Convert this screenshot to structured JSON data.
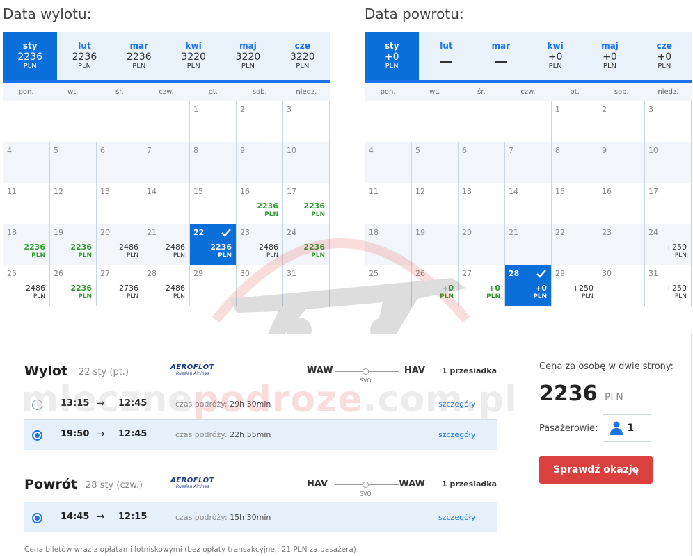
{
  "outbound": {
    "title": "Data wylotu:",
    "months": [
      {
        "name": "sty",
        "price": "2236",
        "currency": "PLN",
        "active": true
      },
      {
        "name": "lut",
        "price": "2236",
        "currency": "PLN"
      },
      {
        "name": "mar",
        "price": "2236",
        "currency": "PLN"
      },
      {
        "name": "kwi",
        "price": "3220",
        "currency": "PLN"
      },
      {
        "name": "maj",
        "price": "3220",
        "currency": "PLN"
      },
      {
        "name": "cze",
        "price": "3220",
        "currency": "PLN"
      }
    ],
    "weekdays": [
      "pon.",
      "wt.",
      "śr.",
      "czw.",
      "pt.",
      "sob.",
      "niedz."
    ],
    "lead_blank": 4,
    "days": [
      {
        "d": "1"
      },
      {
        "d": "2"
      },
      {
        "d": "3"
      },
      {
        "d": "4"
      },
      {
        "d": "5"
      },
      {
        "d": "6"
      },
      {
        "d": "7"
      },
      {
        "d": "8"
      },
      {
        "d": "9"
      },
      {
        "d": "10"
      },
      {
        "d": "11"
      },
      {
        "d": "12"
      },
      {
        "d": "13"
      },
      {
        "d": "14"
      },
      {
        "d": "15"
      },
      {
        "d": "16",
        "p": "2236",
        "c": "PLN",
        "green": true
      },
      {
        "d": "17",
        "p": "2236",
        "c": "PLN",
        "green": true
      },
      {
        "d": "18",
        "p": "2236",
        "c": "PLN",
        "green": true
      },
      {
        "d": "19",
        "p": "2236",
        "c": "PLN",
        "green": true
      },
      {
        "d": "20",
        "p": "2486",
        "c": "PLN"
      },
      {
        "d": "21",
        "p": "2486",
        "c": "PLN"
      },
      {
        "d": "22",
        "p": "2236",
        "c": "PLN",
        "selected": true
      },
      {
        "d": "23",
        "p": "2486",
        "c": "PLN"
      },
      {
        "d": "24",
        "p": "2236",
        "c": "PLN",
        "green": true
      },
      {
        "d": "25",
        "p": "2486",
        "c": "PLN"
      },
      {
        "d": "26",
        "p": "2236",
        "c": "PLN",
        "green": true
      },
      {
        "d": "27",
        "p": "2736",
        "c": "PLN"
      },
      {
        "d": "28",
        "p": "2486",
        "c": "PLN"
      },
      {
        "d": "29"
      },
      {
        "d": "30"
      },
      {
        "d": "31"
      }
    ]
  },
  "return": {
    "title": "Data powrotu:",
    "months": [
      {
        "name": "sty",
        "price": "+0",
        "currency": "PLN",
        "active": true
      },
      {
        "name": "lut",
        "dash": true
      },
      {
        "name": "mar",
        "dash": true
      },
      {
        "name": "kwi",
        "price": "+0",
        "currency": "PLN"
      },
      {
        "name": "maj",
        "price": "+0",
        "currency": "PLN"
      },
      {
        "name": "cze",
        "price": "+0",
        "currency": "PLN"
      }
    ],
    "weekdays": [
      "pon.",
      "wt.",
      "śr.",
      "czw.",
      "pt.",
      "sob.",
      "niedz."
    ],
    "lead_blank": 4,
    "days": [
      {
        "d": "1"
      },
      {
        "d": "2"
      },
      {
        "d": "3"
      },
      {
        "d": "4"
      },
      {
        "d": "5"
      },
      {
        "d": "6"
      },
      {
        "d": "7"
      },
      {
        "d": "8"
      },
      {
        "d": "9"
      },
      {
        "d": "10"
      },
      {
        "d": "11"
      },
      {
        "d": "12"
      },
      {
        "d": "13"
      },
      {
        "d": "14"
      },
      {
        "d": "15"
      },
      {
        "d": "16"
      },
      {
        "d": "17"
      },
      {
        "d": "18"
      },
      {
        "d": "19"
      },
      {
        "d": "20"
      },
      {
        "d": "21"
      },
      {
        "d": "22"
      },
      {
        "d": "23"
      },
      {
        "d": "24",
        "p": "+250",
        "c": "PLN"
      },
      {
        "d": "25"
      },
      {
        "d": "26",
        "p": "+0",
        "c": "PLN",
        "green": true
      },
      {
        "d": "27",
        "p": "+0",
        "c": "PLN",
        "green": true
      },
      {
        "d": "28",
        "p": "+0",
        "c": "PLN",
        "selected": true
      },
      {
        "d": "29",
        "p": "+250",
        "c": "PLN"
      },
      {
        "d": "30"
      },
      {
        "d": "31",
        "p": "+250",
        "c": "PLN"
      }
    ]
  },
  "summary": {
    "outbound": {
      "title": "Wylot",
      "date": "22 sty (pt.)",
      "airline_logo": "AEROFLOT",
      "airline_sub": "Russian Airlines",
      "from": "WAW",
      "to": "HAV",
      "via": "SVO",
      "stops": "1 przesiadka",
      "options": [
        {
          "dep": "13:15",
          "arr": "12:45",
          "dur_label": "czas podróży:",
          "dur": "29h 30min",
          "details": "szczegóły",
          "selected": false
        },
        {
          "dep": "19:50",
          "arr": "12:45",
          "dur_label": "czas podróży:",
          "dur": "22h 55min",
          "details": "szczegóły",
          "selected": true
        }
      ]
    },
    "return": {
      "title": "Powrót",
      "date": "28 sty (czw.)",
      "airline_logo": "AEROFLOT",
      "airline_sub": "Russian Airlines",
      "from": "HAV",
      "to": "WAW",
      "via": "SVO",
      "stops": "1 przesiadka",
      "options": [
        {
          "dep": "14:45",
          "arr": "12:15",
          "dur_label": "czas podróży:",
          "dur": "15h 30min",
          "details": "szczegóły",
          "selected": true
        }
      ]
    },
    "price_label": "Cena za osobę w dwie strony:",
    "price": "2236",
    "price_currency": "PLN",
    "pax_label": "Pasażerowie:",
    "pax_count": "1",
    "cta": "Sprawdź okazję",
    "footnote": "Cena biletów wraz z opłatami lotniskowymi (bez opłaty transakcyjnej: 21 PLN za pasażera)"
  },
  "watermark": {
    "part1": "mleczne",
    "part2": "podroze",
    "part3": ".com.pl"
  },
  "colors": {
    "accent": "#1a73e8",
    "selected": "#0a6fd8",
    "green": "#2e9a2e",
    "cta": "#d9403e"
  }
}
